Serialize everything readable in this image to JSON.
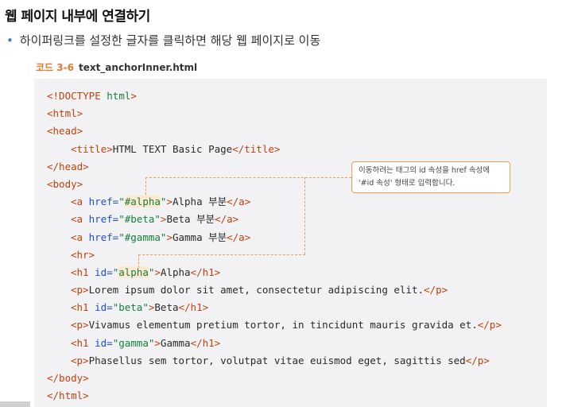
{
  "heading": "웹 페이지 내부에 연결하기",
  "bullet": {
    "marker": "•",
    "text": "하이퍼링크를 설정한 글자를 클릭하면 해당 웹 페이지로 이동"
  },
  "caption": {
    "number": "코드 3-6",
    "filename": "text_anchorInner.html"
  },
  "code": {
    "l1_a": "<!DOCTYPE ",
    "l1_b": "html",
    "l1_c": ">",
    "l2": "<html>",
    "l3": "<head>",
    "l4_open": "<title>",
    "l4_text": "HTML TEXT Basic Page",
    "l4_close": "</title>",
    "l5": "</head>",
    "l6": "<body>",
    "a_open": "<a ",
    "href": "href=",
    "quote": "\"",
    "href_alpha": "#alpha",
    "href_beta": "#beta",
    "href_gamma": "#gamma",
    "gt": ">",
    "a_close": "</a>",
    "text_alpha_link": "Alpha 부분",
    "text_beta_link": "Beta 부분",
    "text_gamma_link": "Gamma 부분",
    "hr": "<hr>",
    "h1_open": "<h1 ",
    "id_attr": "id=",
    "id_alpha": "alpha",
    "id_beta": "beta",
    "id_gamma": "gamma",
    "h1_close": "</h1>",
    "text_alpha": "Alpha",
    "text_beta": "Beta",
    "text_gamma": "Gamma",
    "p_open": "<p>",
    "p_close": "</p>",
    "p1": "Lorem ipsum dolor sit amet, consectetur adipiscing elit.",
    "p2": "Vivamus elementum pretium tortor, in tincidunt mauris gravida et.",
    "p3": "Phasellus sem tortor, volutpat vitae euismod eget, sagittis sed",
    "body_close": "</body>",
    "html_close": "</html>"
  },
  "callout": {
    "line1": "이동하려는 태그의 id 속성을 href 속성에",
    "line2": "'#id 속성' 형태로 입력합니다."
  },
  "colors": {
    "tag": "#c2410c",
    "attribute": "#1d4ed8",
    "value": "#15803d",
    "highlight": "#fde9cf",
    "callout_border": "#f0a050",
    "code_background": "#f2f2f4"
  }
}
